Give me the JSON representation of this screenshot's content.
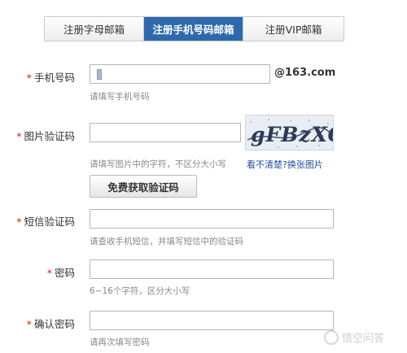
{
  "tabs": [
    {
      "label": "注册字母邮箱",
      "active": false
    },
    {
      "label": "注册手机号码邮箱",
      "active": true
    },
    {
      "label": "注册VIP邮箱",
      "active": false
    }
  ],
  "form": {
    "required_mark": "*",
    "phone": {
      "label": "手机号码",
      "suffix": "@163.com",
      "hint": "请填写手机号码"
    },
    "captcha": {
      "label": "图片验证码",
      "hint": "请填写图片中的字符，不区分大小写",
      "image_text": "gFBzXC",
      "refresh_link": "看不清楚?换张图片"
    },
    "send_button": "免费获取验证码",
    "sms": {
      "label": "短信验证码",
      "hint": "请查收手机短信，并填写短信中的验证码"
    },
    "password": {
      "label": "密码",
      "hint": "6~16个字符，区分大小写"
    },
    "confirm": {
      "label": "确认密码",
      "hint": "请再次填写密码"
    }
  },
  "watermark": {
    "text": "悟空问答"
  },
  "colors": {
    "active_tab": "#2e69ab",
    "required": "#d81e06",
    "link": "#1a4fa0"
  }
}
